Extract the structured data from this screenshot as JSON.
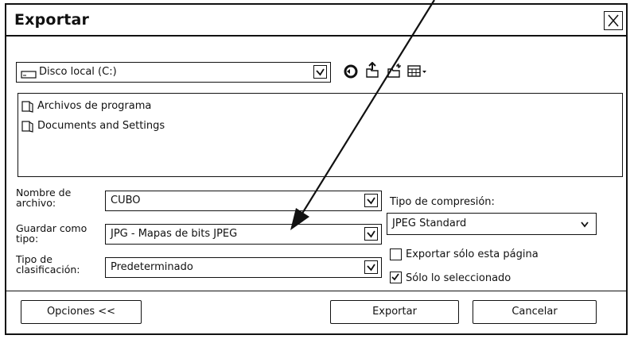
{
  "dialog": {
    "title": "Exportar",
    "close_icon": "close-icon"
  },
  "location": {
    "value": "Disco local (C:)",
    "icon": "drive-icon",
    "toolbar_icons": [
      "back-icon",
      "up-folder-icon",
      "new-folder-icon",
      "view-menu-icon"
    ]
  },
  "files": [
    {
      "name": "Archivos de programa",
      "icon": "folder-icon"
    },
    {
      "name": "Documents and Settings",
      "icon": "folder-icon"
    }
  ],
  "form": {
    "filename_label": "Nombre de archivo:",
    "filename_value": "CUBO",
    "savetype_label": "Guardar como tipo:",
    "savetype_value": "JPG - Mapas de bits JPEG",
    "sorttype_label": "Tipo de clasificación:",
    "sorttype_value": "Predeterminado",
    "compression_label": "Tipo de compresión:",
    "compression_value": "JPEG Standard"
  },
  "options": {
    "export_page_label": "Exportar sólo esta página",
    "export_page_checked": false,
    "selected_only_label": "Sólo lo seleccionado",
    "selected_only_checked": true
  },
  "buttons": {
    "options": "Opciones <<",
    "export": "Exportar",
    "cancel": "Cancelar"
  }
}
